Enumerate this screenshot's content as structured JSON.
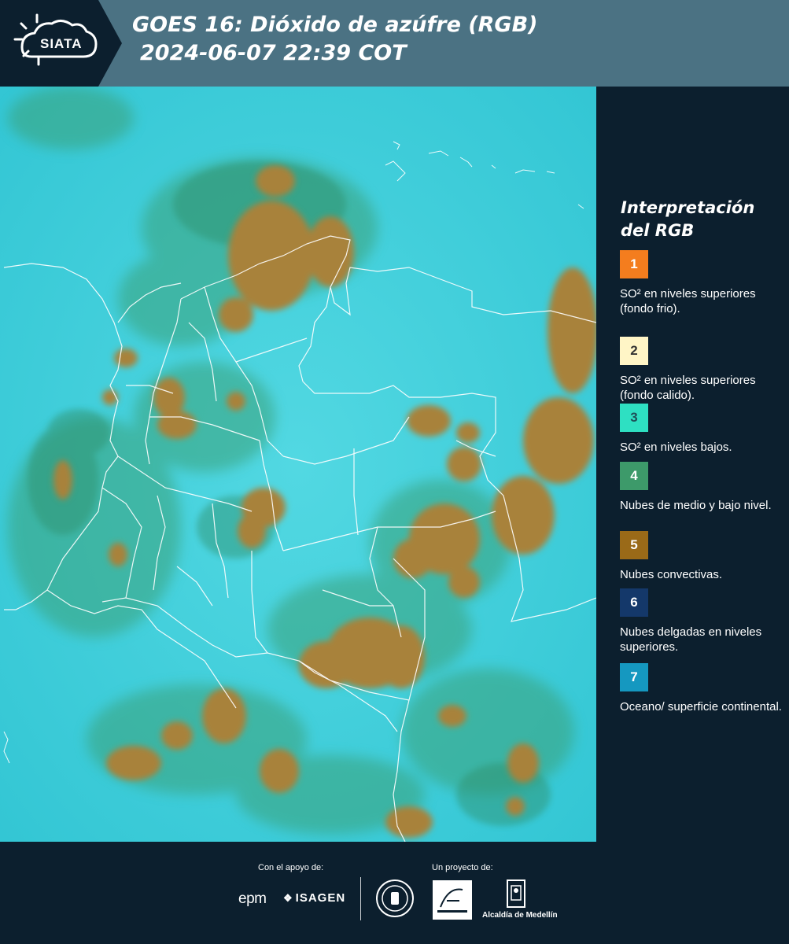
{
  "header": {
    "logo_text": "SIATA",
    "title_line1": "GOES 16: Dióxido de azúfre (RGB)",
    "title_line2": "2024-06-07 22:39 COT"
  },
  "map": {
    "background_color": "#3ed3de",
    "convective_color": "#a8823a",
    "midlevel_color": "#3d9a6a",
    "border_color": "#ffffff"
  },
  "legend": {
    "title_line1": "Interpretación",
    "title_line2": "del RGB",
    "items": [
      {
        "number": "1",
        "color": "#f47d1e",
        "number_color": "#ffffff",
        "text": "SO² en niveles superiores (fondo frio)."
      },
      {
        "number": "2",
        "color": "#fff5c6",
        "number_color": "#333333",
        "text": "SO² en niveles superiores (fondo calido)."
      },
      {
        "number": "3",
        "color": "#2ee0c2",
        "number_color": "#1f4f57",
        "text": "SO² en niveles bajos."
      },
      {
        "number": "4",
        "color": "#3d9a6a",
        "number_color": "#ffffff",
        "text": "Nubes de medio y bajo nivel."
      },
      {
        "number": "5",
        "color": "#9a6a18",
        "number_color": "#ffffff",
        "text": "Nubes convectivas."
      },
      {
        "number": "6",
        "color": "#14386a",
        "number_color": "#ffffff",
        "text": "Nubes delgadas en niveles superiores."
      },
      {
        "number": "7",
        "color": "#1598c0",
        "number_color": "#ffffff",
        "text": "Oceano/ superficie continental."
      }
    ]
  },
  "footer": {
    "support_label": "Con el apoyo de:",
    "project_label": "Un proyecto de:",
    "epm": "epm",
    "isagen": "ISAGEN",
    "alcaldia": "Alcaldía de Medellín"
  }
}
